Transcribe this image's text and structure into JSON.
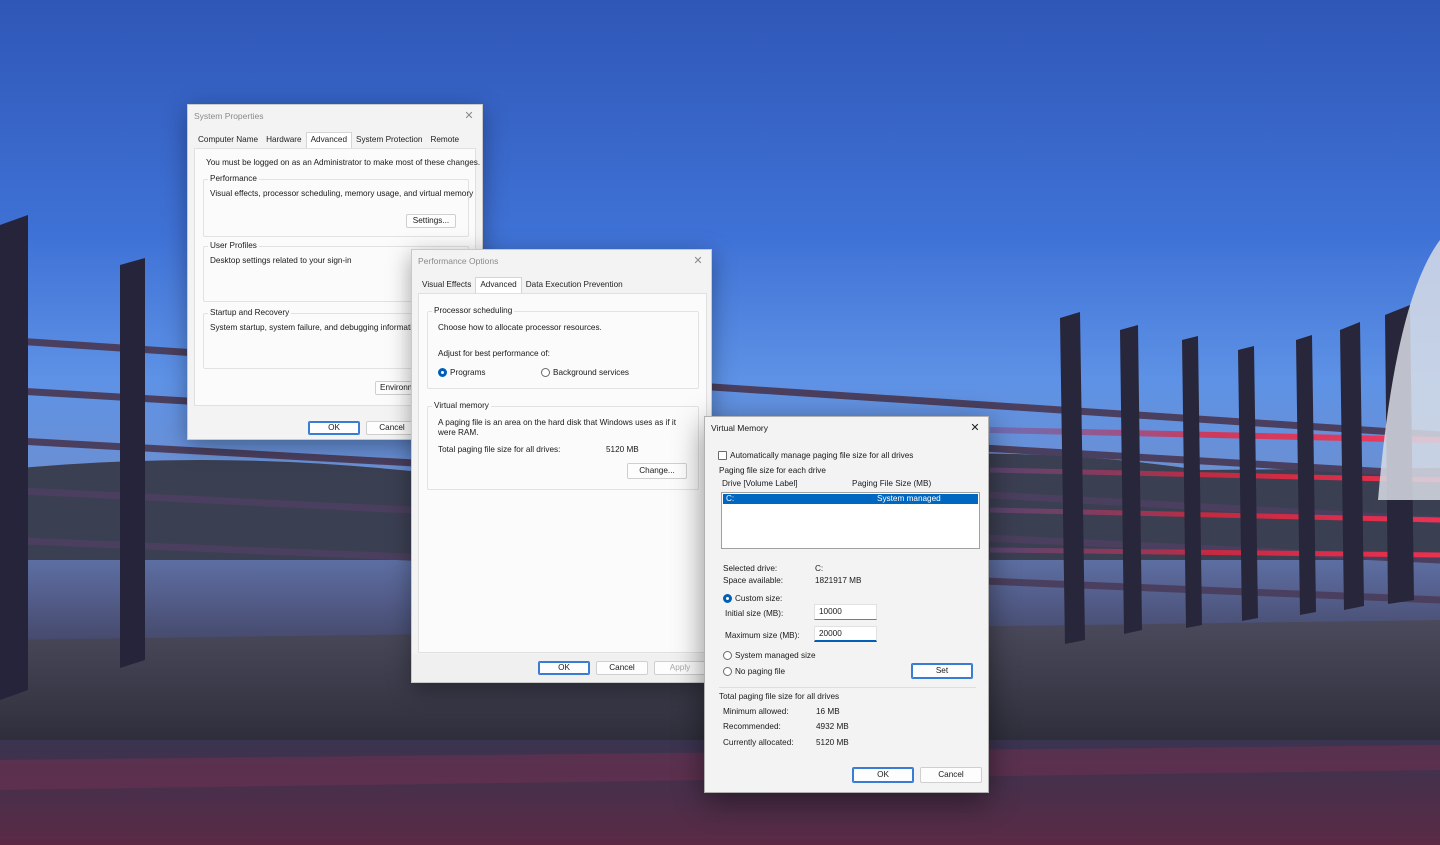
{
  "system_properties": {
    "title": "System Properties",
    "tabs": [
      "Computer Name",
      "Hardware",
      "Advanced",
      "System Protection",
      "Remote"
    ],
    "selected_tab": "Advanced",
    "admin_note": "You must be logged on as an Administrator to make most of these changes.",
    "performance": {
      "title": "Performance",
      "description": "Visual effects, processor scheduling, memory usage, and virtual memory",
      "settings_label": "Settings..."
    },
    "user_profiles": {
      "title": "User Profiles",
      "description": "Desktop settings related to your sign-in"
    },
    "startup": {
      "title": "Startup and Recovery",
      "description": "System startup, system failure, and debugging information"
    },
    "environment_label": "Environme",
    "ok_label": "OK",
    "cancel_label": "Cancel"
  },
  "performance_options": {
    "title": "Performance Options",
    "tabs": [
      "Visual Effects",
      "Advanced",
      "Data Execution Prevention"
    ],
    "selected_tab": "Advanced",
    "processor_scheduling": {
      "title": "Processor scheduling",
      "description": "Choose how to allocate processor resources.",
      "adjust_label": "Adjust for best performance of:",
      "programs_label": "Programs",
      "background_label": "Background services",
      "selected": "Programs"
    },
    "virtual_memory": {
      "title": "Virtual memory",
      "description_line1": "A paging file is an area on the hard disk that Windows uses as if it",
      "description_line2": "were RAM.",
      "total_label": "Total paging file size for all drives:",
      "total_value": "5120 MB",
      "change_label": "Change..."
    },
    "ok_label": "OK",
    "cancel_label": "Cancel",
    "apply_label": "Apply"
  },
  "virtual_memory": {
    "title": "Virtual Memory",
    "auto_manage_label": "Automatically manage paging file size for all drives",
    "auto_manage_checked": false,
    "per_drive_label": "Paging file size for each drive",
    "col_drive": "Drive  [Volume Label]",
    "col_size": "Paging File Size (MB)",
    "rows": [
      {
        "drive": "C:",
        "size": "System managed"
      }
    ],
    "selected_drive_label": "Selected drive:",
    "selected_drive_value": "C:",
    "space_available_label": "Space available:",
    "space_available_value": "1821917 MB",
    "custom_size_label": "Custom size:",
    "initial_size_label": "Initial size (MB):",
    "initial_size_value": "10000",
    "maximum_size_label": "Maximum size (MB):",
    "maximum_size_value": "20000",
    "system_managed_label": "System managed size",
    "no_paging_label": "No paging file",
    "size_mode": "Custom size",
    "set_label": "Set",
    "totals_title": "Total paging file size for all drives",
    "minimum_label": "Minimum allowed:",
    "minimum_value": "16 MB",
    "recommended_label": "Recommended:",
    "recommended_value": "4932 MB",
    "allocated_label": "Currently allocated:",
    "allocated_value": "5120 MB",
    "ok_label": "OK",
    "cancel_label": "Cancel"
  },
  "colors": {
    "accent": "#005fb8",
    "selection": "#0067c0",
    "sky_top": "#2f57b7",
    "railing_light": "#e8243c"
  },
  "icons": {
    "close": "close-icon"
  }
}
